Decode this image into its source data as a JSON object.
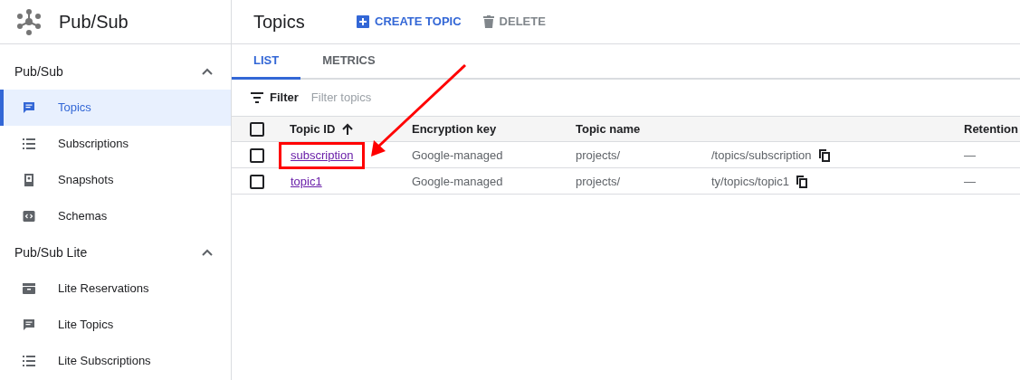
{
  "product": {
    "title": "Pub/Sub"
  },
  "sidebar": {
    "sections": [
      {
        "title": "Pub/Sub",
        "expanded": true,
        "items": [
          {
            "label": "Topics",
            "kind": "topic",
            "selected": true
          },
          {
            "label": "Subscriptions",
            "kind": "list",
            "selected": false
          },
          {
            "label": "Snapshots",
            "kind": "snapshot",
            "selected": false
          },
          {
            "label": "Schemas",
            "kind": "schema",
            "selected": false
          }
        ]
      },
      {
        "title": "Pub/Sub Lite",
        "expanded": true,
        "items": [
          {
            "label": "Lite Reservations",
            "kind": "reservation",
            "selected": false
          },
          {
            "label": "Lite Topics",
            "kind": "topic",
            "selected": false
          },
          {
            "label": "Lite Subscriptions",
            "kind": "list",
            "selected": false
          }
        ]
      }
    ]
  },
  "page": {
    "title": "Topics",
    "actions": [
      {
        "label": "CREATE TOPIC",
        "kind": "create",
        "disabled": false
      },
      {
        "label": "DELETE",
        "kind": "delete",
        "disabled": true
      }
    ]
  },
  "tabs": [
    {
      "label": "LIST",
      "selected": true
    },
    {
      "label": "METRICS",
      "selected": false
    }
  ],
  "filter": {
    "label": "Filter",
    "placeholder": "Filter topics"
  },
  "table": {
    "all_checked": false,
    "columns": [
      "Topic ID",
      "Encryption key",
      "Topic name",
      "Retention"
    ],
    "rows": [
      {
        "checked": false,
        "topic_id": "subscription",
        "encryption_key": "Google-managed",
        "name_start": "projects/",
        "name_end": "/topics/subscription",
        "retention": "—",
        "highlighted": true
      },
      {
        "checked": false,
        "topic_id": "topic1",
        "encryption_key": "Google-managed",
        "name_start": "projects/",
        "name_end": "ty/topics/topic1",
        "retention": "—",
        "highlighted": false
      }
    ]
  }
}
